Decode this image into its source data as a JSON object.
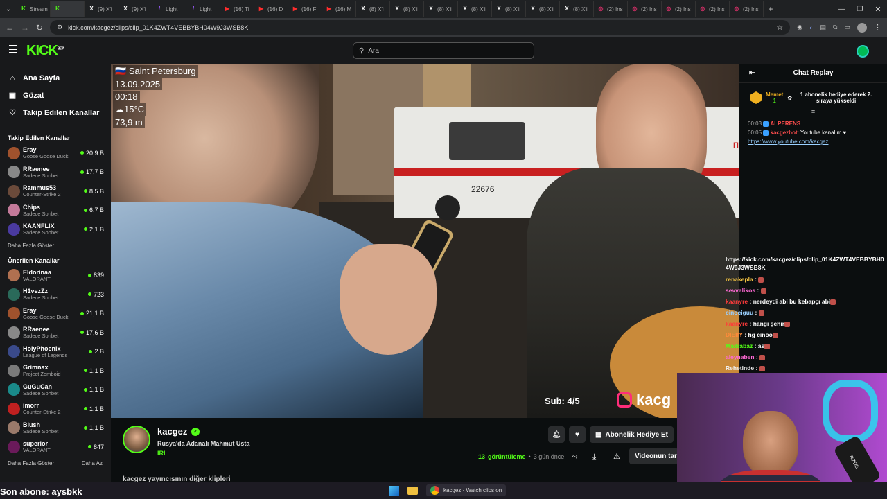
{
  "browser": {
    "tabs": [
      {
        "label": "Stream",
        "fav": "K",
        "color": "#53fc18"
      },
      {
        "label": "",
        "fav": "K",
        "color": "#53fc18",
        "active": true
      },
      {
        "label": "(9) X'i",
        "fav": "X",
        "color": "#fff"
      },
      {
        "label": "(9) X'i",
        "fav": "X",
        "color": "#fff"
      },
      {
        "label": "Light",
        "fav": "/",
        "color": "#9b5cff"
      },
      {
        "label": "Light",
        "fav": "/",
        "color": "#9b5cff"
      },
      {
        "label": "(16) Ti",
        "fav": "▶",
        "color": "#ff2d2d"
      },
      {
        "label": "(16) D",
        "fav": "▶",
        "color": "#ff2d2d"
      },
      {
        "label": "(16) F",
        "fav": "▶",
        "color": "#ff2d2d"
      },
      {
        "label": "(16) M",
        "fav": "▶",
        "color": "#ff2d2d"
      },
      {
        "label": "(8) X'i",
        "fav": "X",
        "color": "#fff"
      },
      {
        "label": "(8) X'i",
        "fav": "X",
        "color": "#fff"
      },
      {
        "label": "(8) X'i",
        "fav": "X",
        "color": "#fff"
      },
      {
        "label": "(8) X'i",
        "fav": "X",
        "color": "#fff"
      },
      {
        "label": "(8) X'i",
        "fav": "X",
        "color": "#fff"
      },
      {
        "label": "(8) X'i",
        "fav": "X",
        "color": "#fff"
      },
      {
        "label": "(8) X'i",
        "fav": "X",
        "color": "#fff"
      },
      {
        "label": "(2) Ins",
        "fav": "◎",
        "color": "#e1306c"
      },
      {
        "label": "(2) Ins",
        "fav": "◎",
        "color": "#e1306c"
      },
      {
        "label": "(2) Ins",
        "fav": "◎",
        "color": "#e1306c"
      },
      {
        "label": "(2) Ins",
        "fav": "◎",
        "color": "#e1306c"
      },
      {
        "label": "(2) Ins",
        "fav": "◎",
        "color": "#e1306c"
      }
    ],
    "url": "kick.com/kacgez/clips/clip_01K4ZWT4VEBBYBH04W9J3WSB8K"
  },
  "header": {
    "logo": "KICK",
    "logo_beta": "BETA",
    "search_placeholder": "Ara"
  },
  "sidebar": {
    "nav": [
      {
        "label": "Ana Sayfa",
        "icon": "⌂"
      },
      {
        "label": "Gözat",
        "icon": "▣"
      },
      {
        "label": "Takip Edilen Kanallar",
        "icon": "♡"
      }
    ],
    "followed_title": "Takip Edilen Kanallar",
    "followed": [
      {
        "name": "Eray",
        "cat": "Goose Goose Duck",
        "views": "20,9 B",
        "color": "#a0522d"
      },
      {
        "name": "RRaenee",
        "cat": "Sadece Sohbet",
        "views": "17,7 B",
        "color": "#888"
      },
      {
        "name": "Rammus53",
        "cat": "Counter-Strike 2",
        "views": "8,5 B",
        "color": "#6b4a3a"
      },
      {
        "name": "Chips",
        "cat": "Sadece Sohbet",
        "views": "6,7 B",
        "color": "#c47a9a"
      },
      {
        "name": "KAANFLIX",
        "cat": "Sadece Sohbet",
        "views": "2,1 B",
        "color": "#4a3aa0"
      }
    ],
    "more_label": "Daha Fazla Göster",
    "recommended_title": "Önerilen Kanallar",
    "recommended": [
      {
        "name": "Eldorinaa",
        "cat": "VALORANT",
        "views": "839",
        "color": "#b07050"
      },
      {
        "name": "H1vezZz",
        "cat": "Sadece Sohbet",
        "views": "723",
        "color": "#2a6a5a"
      },
      {
        "name": "Eray",
        "cat": "Goose Goose Duck",
        "views": "21,1 B",
        "color": "#a0522d"
      },
      {
        "name": "RRaenee",
        "cat": "Sadece Sohbet",
        "views": "17,6 B",
        "color": "#888"
      },
      {
        "name": "HolyPhoenix",
        "cat": "League of Legends",
        "views": "2 B",
        "color": "#3a4a8a"
      },
      {
        "name": "Grimnax",
        "cat": "Project Zomboid",
        "views": "1,1 B",
        "color": "#7a7a7a"
      },
      {
        "name": "GuGuCan",
        "cat": "Sadece Sohbet",
        "views": "1,1 B",
        "color": "#1a8a8a"
      },
      {
        "name": "imorr",
        "cat": "Counter-Strike 2",
        "views": "1,1 B",
        "color": "#c02020"
      },
      {
        "name": "Blush",
        "cat": "Sadece Sohbet",
        "views": "1,1 B",
        "color": "#9a7a6a"
      },
      {
        "name": "superior",
        "cat": "VALORANT",
        "views": "847",
        "color": "#6a1a5a"
      }
    ],
    "more_label2": "Daha Fazla Göster",
    "less_label": "Daha Az"
  },
  "video": {
    "overlay": [
      "Saint Petersburg",
      "13.09.2025",
      "00:18",
      "15°C",
      "73,9 m"
    ],
    "sub_count": "Sub: 4/5",
    "watermark": "kacg",
    "ambulance_num": "22676",
    "ambulance_text": "ПОМО"
  },
  "channel": {
    "name": "kacgez",
    "title": "Rusya'da Adanalı Mahmut Usta",
    "category": "IRL",
    "gift_label": "Abonelik Hediye Et",
    "views_count": "13",
    "views_label": "görüntüleme",
    "time_ago": "3 gün önce",
    "watch_label": "Videonun tar",
    "other_clips_label": "kacgez yayıncısının diğer klipleri"
  },
  "chat": {
    "title": "Chat Replay",
    "pinned_user": "Memet",
    "pinned_count": "1",
    "pinned_text": "1 abonelik hediye ederek 2. sıraya yükseldi",
    "messages": [
      {
        "time": "00:03",
        "user": "ALPERENS",
        "text": "",
        "color": "#ff4d4d"
      },
      {
        "time": "00:05",
        "user": "kacgezbot",
        "text": ": Youtube kanalım ♥",
        "color": "#ff4d4d"
      }
    ],
    "link": "https://www.youtube.com/kacgez",
    "lower_link": "https://kick.com/kacgez/clips/clip_01K4ZWT4VEBBYBH04W9J3WSB8K",
    "lower_messages": [
      {
        "user": "renakepla",
        "text": " : ",
        "color": "#f0c040"
      },
      {
        "user": "sevvalikos",
        "text": " : ",
        "color": "#ff6ad5"
      },
      {
        "user": "kaanyre",
        "text": " : nerdeydi abi bu kebapçı abi",
        "color": "#ff3b3b"
      },
      {
        "user": "cinociguu",
        "text": " : ",
        "color": "#9ad0ff"
      },
      {
        "user": "kaanyre",
        "text": " : hangi şehir",
        "color": "#ff3b3b"
      },
      {
        "user": "DIEIfY",
        "text": " : hg cinoo",
        "color": "#ff8a3b"
      },
      {
        "user": "Madrabaz",
        "text": " : as",
        "color": "#53fc18"
      },
      {
        "user": "aleynaben",
        "text": " : ",
        "color": "#ff6ad5"
      },
      {
        "user": "Rehetinde",
        "text": " : ",
        "color": "#f0f0f0"
      }
    ]
  },
  "webcam": {
    "brand": "RØDE"
  },
  "taskbar": {
    "subscriber_label": "Son abone: aysbkk",
    "app_label": "kacgez - Watch clips on"
  }
}
